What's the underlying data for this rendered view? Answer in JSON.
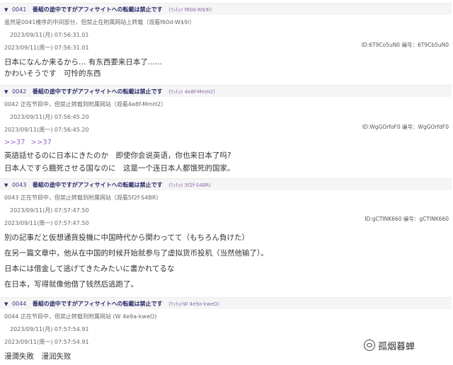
{
  "posts": [
    {
      "num": "0041",
      "title": "番組の途中ですがアフィサイトへの転載は禁止です",
      "uid": "(ﾜｯﾁｮｲ f60d-W$9i)",
      "meta1": "虽然是0041楼序的中间部分，但禁止在附属网站上转载（观看f60d-W$9i）",
      "time1": "2023/09/11(月) 07:56:31.01",
      "time2": "2023/09/11(周一) 07:56:31.01",
      "right_id": "ID:6T9Co5uN0 编号：6T9Cb5uN0",
      "lines": [
        "日本になんか来るから… 有东西要来日本了......",
        "かわいそうです　可怜的东西"
      ]
    },
    {
      "num": "0042",
      "title": "番組の途中ですがアフィサイトへの転載は禁止です",
      "uid": "(ﾜｯﾁｮｲ 4e8f-MmH2)",
      "meta1": "0042 正在节目中，但禁止转载到附属网站（观看4e8f-MmH2）",
      "time1": "2023/09/11(月) 07:56:45.20",
      "time2": "2023/09/11(周一) 07:56:45.20",
      "right_id": "ID:WgGOrfoF0 编号：WgGOrfdF0",
      "replies": [
        ">>37",
        ">>37"
      ],
      "lines": [
        "英語話せるのに日本にきたのか　即使你会说英语，你也来日本了吗?",
        "日本人ですら餓死させる国なのに　这是一个连日本人都饿死的国家。"
      ]
    },
    {
      "num": "0043",
      "title": "番組の途中ですがアフィサイトへの転載は禁止です",
      "uid": "(ﾜｯﾁｮｲ 5f2f-S4BR)",
      "meta1": "0043 正在节目中，但禁止转载到附属网站（观看5f2f-S4BR）",
      "time1": "2023/09/11(月) 07:57:47.50",
      "time2": "2023/09/11(周一) 07:57:47.50",
      "right_id": "ID:gCTINK660 编号：gCTINK660",
      "lines": [
        "別の記事だと仮想通貨投機に中国時代から関わってて（もちろん負けた）",
        "在另一篇文章中，他从在中国的时候开始就参与了虚拟货币投机（当然他输了）。",
        "日本には借金して逃げてきたみたいに書かれてるな",
        "在日本，写得就像他借了钱然后逃跑了。"
      ]
    },
    {
      "num": "0044",
      "title": "番組の途中ですがアフィサイトへの転載は禁止です",
      "uid": "(ﾜｯﾁｮｲW 4e9a-kweO)",
      "meta1": "0044 正在节目中，但禁止转载到附属网站 (W 4e9a-kweO)",
      "time1": "2023/09/11(月) 07:57:54.91",
      "time2": "2023/09/11(周一) 07:57:54.91",
      "lines": [
        "漫潤失敗　漫润失败"
      ]
    }
  ],
  "watermark": "孤烟暮蝉"
}
